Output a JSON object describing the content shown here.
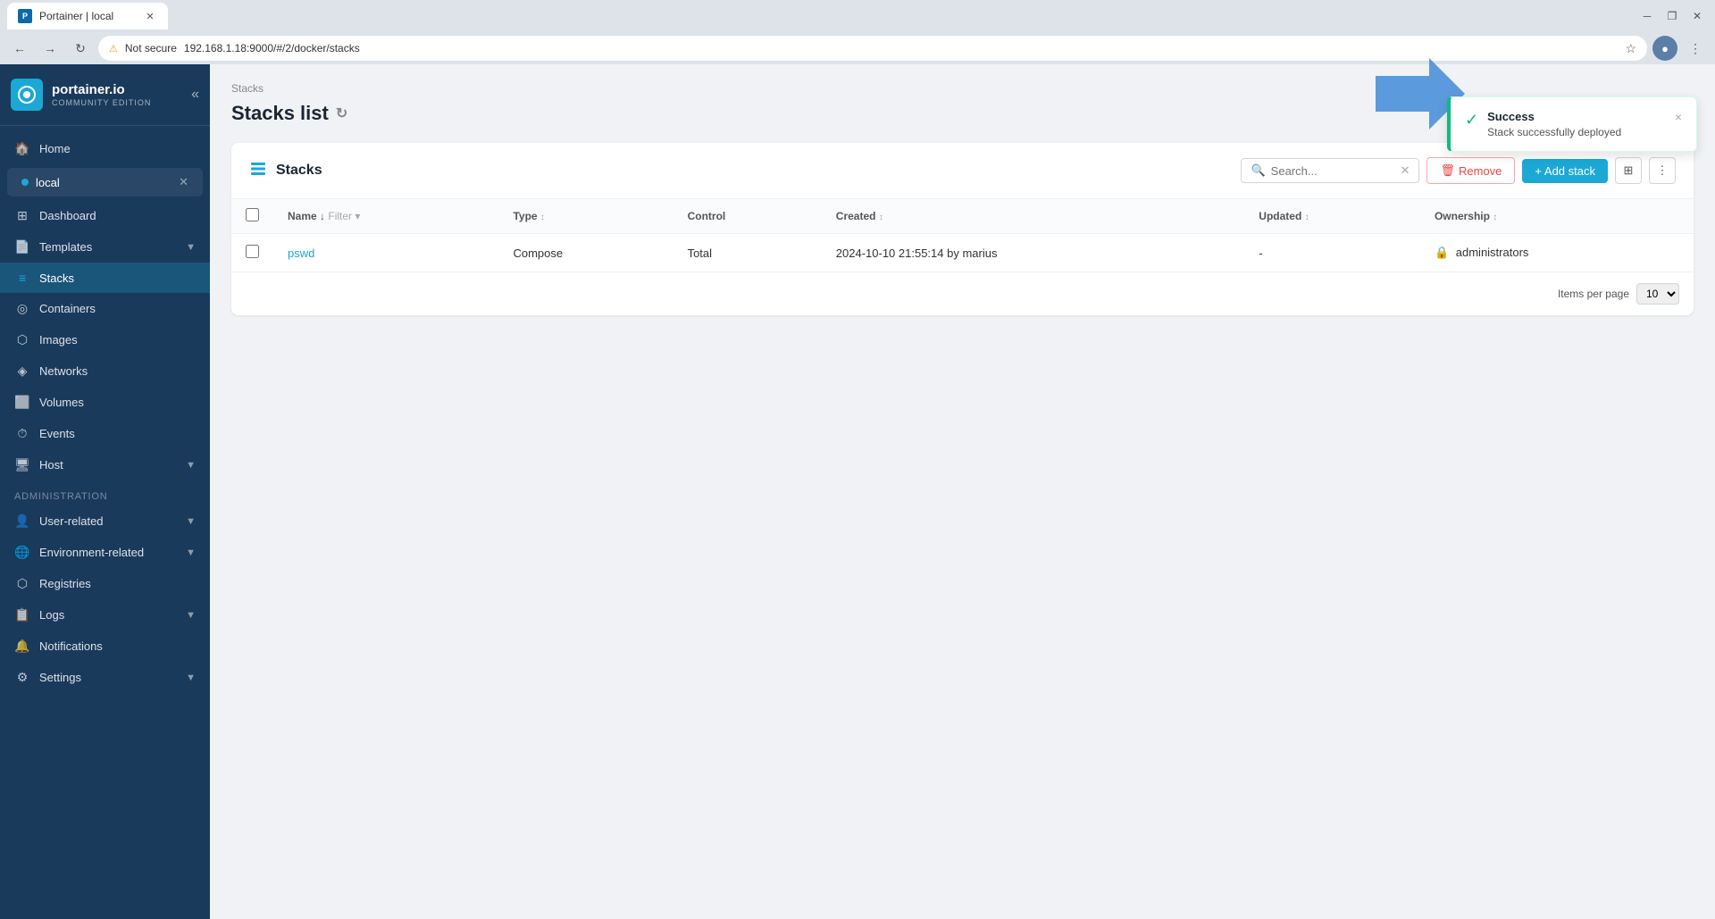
{
  "browser": {
    "tab_title": "Portainer | local",
    "url": "192.168.1.18:9000/#/2/docker/stacks",
    "warning_text": "Not secure"
  },
  "sidebar": {
    "logo_text": "portainer.io",
    "logo_sub": "COMMUNITY EDITION",
    "env_name": "local",
    "nav_items": [
      {
        "id": "home",
        "label": "Home",
        "icon": "🏠"
      },
      {
        "id": "dashboard",
        "label": "Dashboard",
        "icon": "⊞"
      },
      {
        "id": "templates",
        "label": "Templates",
        "icon": "📄",
        "has_arrow": true
      },
      {
        "id": "stacks",
        "label": "Stacks",
        "icon": "≡",
        "active": true
      },
      {
        "id": "containers",
        "label": "Containers",
        "icon": "◎"
      },
      {
        "id": "images",
        "label": "Images",
        "icon": "⬡"
      },
      {
        "id": "networks",
        "label": "Networks",
        "icon": "◈"
      },
      {
        "id": "volumes",
        "label": "Volumes",
        "icon": "⬜"
      },
      {
        "id": "events",
        "label": "Events",
        "icon": "⏱"
      },
      {
        "id": "host",
        "label": "Host",
        "icon": "🖥",
        "has_arrow": true
      }
    ],
    "admin_section": "Administration",
    "admin_items": [
      {
        "id": "user-related",
        "label": "User-related",
        "icon": "👤",
        "has_arrow": true
      },
      {
        "id": "environment-related",
        "label": "Environment-related",
        "icon": "🌐",
        "has_arrow": true
      },
      {
        "id": "registries",
        "label": "Registries",
        "icon": "⬡"
      },
      {
        "id": "logs",
        "label": "Logs",
        "icon": "📋",
        "has_arrow": true
      },
      {
        "id": "notifications",
        "label": "Notifications",
        "icon": "🔔"
      },
      {
        "id": "settings",
        "label": "Settings",
        "icon": "⚙",
        "has_arrow": true
      }
    ]
  },
  "breadcrumb": "Stacks",
  "page_title": "Stacks list",
  "panel": {
    "title": "Stacks",
    "search_placeholder": "Search...",
    "remove_label": "Remove",
    "add_label": "+ Add stack",
    "items_per_page_label": "Items per page",
    "items_per_page_value": "10",
    "table": {
      "columns": [
        "Name",
        "Type",
        "Control",
        "Created",
        "Updated",
        "Ownership"
      ],
      "rows": [
        {
          "name": "pswd",
          "type": "Compose",
          "control": "Total",
          "created": "2024-10-10 21:55:14 by marius",
          "updated": "-",
          "ownership": "administrators"
        }
      ]
    }
  },
  "toast": {
    "title": "Success",
    "message": "Stack successfully deployed",
    "close_label": "×"
  }
}
